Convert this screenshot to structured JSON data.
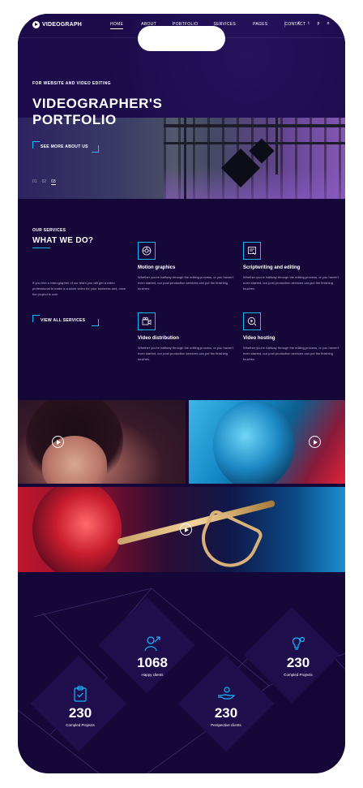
{
  "header": {
    "logo_text": "VIDEOGRAPH",
    "nav": [
      "HOME",
      "ABOUT",
      "PORTFOLIO",
      "SERVICES",
      "PAGES",
      "CONTACT"
    ],
    "active_nav": "HOME",
    "social_icons": [
      "facebook-icon",
      "twitter-icon",
      "pinterest-icon",
      "instagram-icon"
    ],
    "social_glyphs": [
      "f",
      "t",
      "p",
      "o"
    ]
  },
  "hero": {
    "eyebrow": "FOR WEBSITE AND VIDEO EDITING",
    "title_line1": "VIDEOGRAPHER'S",
    "title_line2": "PORTFOLIO",
    "button": "SEE MORE ABOUT US",
    "slides": [
      "01",
      "02",
      "03"
    ],
    "active_slide": "03"
  },
  "services": {
    "eyebrow": "OUR SERVICES",
    "title": "WHAT WE DO?",
    "description": "If you hire a videographer of our team you will get a video professional to make a custom video for your business and, once the project is over.",
    "button": "VIEW ALL SERVICES",
    "items": [
      {
        "icon": "motion-graphics-icon",
        "title": "Motion graphics",
        "text": "Whether you're halfway through the editing process, or you haven't even started, our post production services can put the finishing touches."
      },
      {
        "icon": "scriptwriting-icon",
        "title": "Scriptwriting and editing",
        "text": "Whether you're halfway through the editing process, or you haven't even started, our post production services can put the finishing touches."
      },
      {
        "icon": "video-distribution-icon",
        "title": "Video distribution",
        "text": "Whether you're halfway through the editing process, or you haven't even started, our post production services can put the finishing touches."
      },
      {
        "icon": "video-hosting-icon",
        "title": "Video hosting",
        "text": "Whether you're halfway through the editing process, or you haven't even started, our post production services can put the finishing touches."
      }
    ]
  },
  "stats": [
    {
      "icon": "happy-clients-icon",
      "value": "1068",
      "label": "Happy clients"
    },
    {
      "icon": "lightbulb-gear-icon",
      "value": "230",
      "label": "Compled Projects"
    },
    {
      "icon": "clipboard-check-icon",
      "value": "230",
      "label": "Compled Projects"
    },
    {
      "icon": "hand-gear-icon",
      "value": "230",
      "label": "Perspective clients"
    }
  ],
  "colors": {
    "background": "#150838",
    "accent": "#17b6ff",
    "hero": "#1b0b4a"
  }
}
